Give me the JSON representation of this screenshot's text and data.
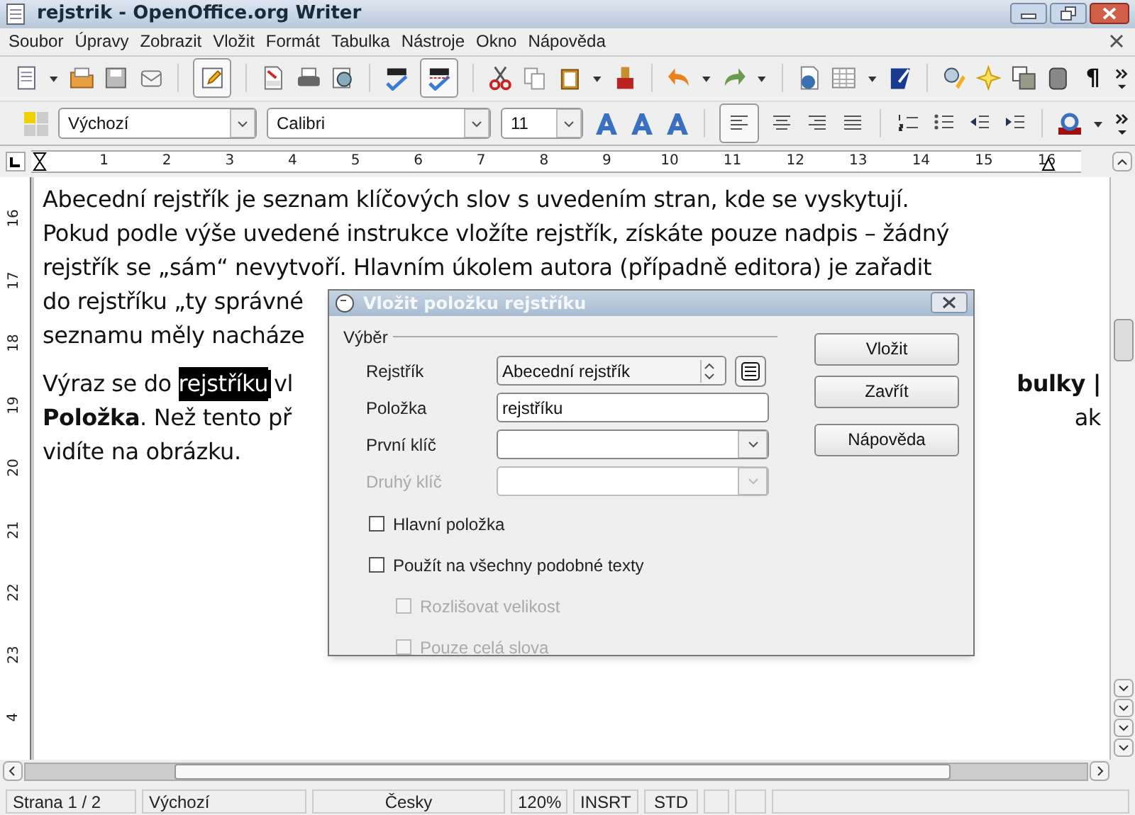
{
  "window": {
    "title": "rejstrik - OpenOffice.org Writer"
  },
  "menu": [
    {
      "label": "Soubor"
    },
    {
      "label": "Úpravy"
    },
    {
      "label": "Zobrazit"
    },
    {
      "label": "Vložit"
    },
    {
      "label": "Formát"
    },
    {
      "label": "Tabulka"
    },
    {
      "label": "Nástroje"
    },
    {
      "label": "Okno"
    },
    {
      "label": "Nápověda"
    }
  ],
  "toolbar": {
    "formatting_marks": "¶"
  },
  "formatting": {
    "style": "Výchozí",
    "font": "Calibri",
    "size": "11"
  },
  "ruler": {
    "numbers": [
      "1",
      "2",
      "3",
      "4",
      "5",
      "6",
      "7",
      "8",
      "9",
      "10",
      "11",
      "12",
      "13",
      "14",
      "15",
      "16"
    ]
  },
  "vertical_ruler": {
    "numbers": [
      "16",
      "17",
      "18",
      "19",
      "20",
      "21",
      "22",
      "23",
      "4"
    ]
  },
  "document": {
    "paragraphs": [
      {
        "lines": [
          {
            "left": "Abecední rejstřík je seznam klíčových slov s uvedením stran, kde se vyskytují."
          },
          {
            "left": "Pokud podle výše uvedené instrukce vložíte rejstřík, získáte pouze nadpis – žádný"
          },
          {
            "left": "rejstřík se „sám“ nevytvoří. Hlavním úkolem autora (případně editora) je zařadit"
          },
          {
            "left": "do rejstříku „ty správné"
          },
          {
            "left": "seznamu měly nacháze"
          }
        ]
      },
      {
        "lines": [
          {
            "left": "Výraz se do ",
            "selected_text": "rejstříku",
            "after": "vl",
            "right": "**bulky |**"
          },
          {
            "left": "**Položka**. Než tento př",
            "right": "ak"
          },
          {
            "left": "vidíte na obrázku."
          }
        ]
      }
    ]
  },
  "dialog": {
    "title": "Vložit položku rejstříku",
    "group": "Výběr",
    "fields": [
      {
        "label": "Rejstřík",
        "kind": "spin",
        "value": "Abecední rejstřík",
        "disabled": false
      },
      {
        "label": "Položka",
        "kind": "text",
        "value": "rejstříku",
        "disabled": false
      },
      {
        "label": "První klíč",
        "kind": "combo",
        "disabled": false
      },
      {
        "label": "Druhý klíč",
        "kind": "combo",
        "disabled": true
      }
    ],
    "checkboxes": [
      {
        "label": "Hlavní položka",
        "checked": false,
        "disabled": false
      },
      {
        "label": "Použít na všechny podobné texty",
        "checked": false,
        "disabled": false,
        "children": [
          {
            "label": "Rozlišovat velikost",
            "checked": false,
            "disabled": true
          },
          {
            "label": "Pouze celá slova",
            "checked": false,
            "disabled": true
          }
        ]
      }
    ],
    "buttons": [
      {
        "label": "Vložit"
      },
      {
        "label": "Zavřít"
      },
      {
        "label": "Nápověda"
      }
    ]
  },
  "status_bar": [
    "Strana 1 / 2",
    "Výchozí",
    "Česky",
    "120%",
    "INSRT",
    "STD"
  ]
}
